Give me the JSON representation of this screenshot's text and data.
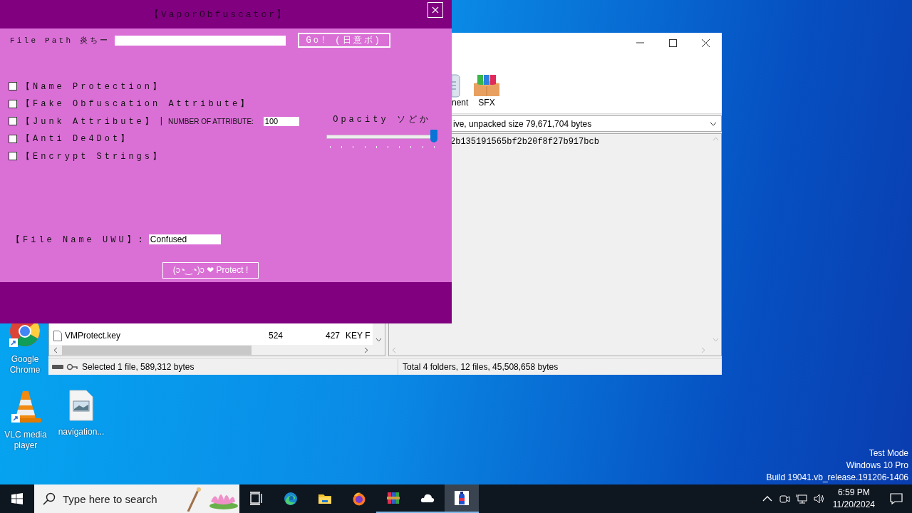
{
  "app": {
    "title": "【VaporObfuscator】",
    "file_path": {
      "label": "File Path 炎ちー"
    },
    "go_button": "Go! (日意ボ)",
    "options": [
      {
        "label": "【Name Protection】",
        "checked": false
      },
      {
        "label": "【Fake Obfuscation Attribute】",
        "checked": false
      },
      {
        "label": "【Junk Attribute】",
        "checked": false,
        "separator": "|",
        "count_label": "NUMBER OF ATTRIBUTE:",
        "count": "100"
      },
      {
        "label": "【Anti De4Dot】",
        "checked": false
      },
      {
        "label": "【Encrypt Strings】",
        "checked": false
      }
    ],
    "opacity": {
      "label": "Opacity ソどか",
      "level": 1
    },
    "file_name": {
      "label": "【File Name UWU】:",
      "value": "Confused"
    },
    "protect_button": "(ɔ◔‿◔)ɔ ❤ Protect !"
  },
  "archive_window": {
    "toolbar": [
      {
        "label": "nent",
        "kind": "partial"
      },
      {
        "label": "SFX",
        "kind": "sfx"
      }
    ],
    "info": "ive, unpacked size 79,671,704 bytes",
    "files": [
      {
        "name": "VMProtect.key",
        "size": "524",
        "packed": "427",
        "type": "KEY F"
      }
    ],
    "comment": "2b135191565bf2b20f8f27b917bcb",
    "status_left": "Selected 1 file, 589,312 bytes",
    "status_right": "Total 4 folders, 12 files, 45,508,658 bytes"
  },
  "desktop_icons": [
    {
      "label": "Google Chrome",
      "kind": "chrome"
    },
    {
      "label": "VLC media player",
      "kind": "vlc"
    },
    {
      "label": "navigation...",
      "kind": "image"
    }
  ],
  "taskbar": {
    "search": {
      "placeholder": "Type here to search"
    },
    "apps": [
      {
        "kind": "taskview",
        "running": false,
        "selected": false
      },
      {
        "kind": "edge",
        "running": false,
        "selected": false
      },
      {
        "kind": "explorer",
        "running": false,
        "selected": false
      },
      {
        "kind": "firefox",
        "running": false,
        "selected": false
      },
      {
        "kind": "winrar",
        "running": true,
        "selected": false
      },
      {
        "kind": "onedrive",
        "running": true,
        "selected": false
      },
      {
        "kind": "bottle",
        "running": true,
        "selected": true
      }
    ],
    "time": "6:59 PM",
    "date": "11/20/2024"
  },
  "system_watermark": [
    "Test Mode",
    "Windows 10 Pro",
    "Build 19041.vb_release.191206-1406"
  ]
}
